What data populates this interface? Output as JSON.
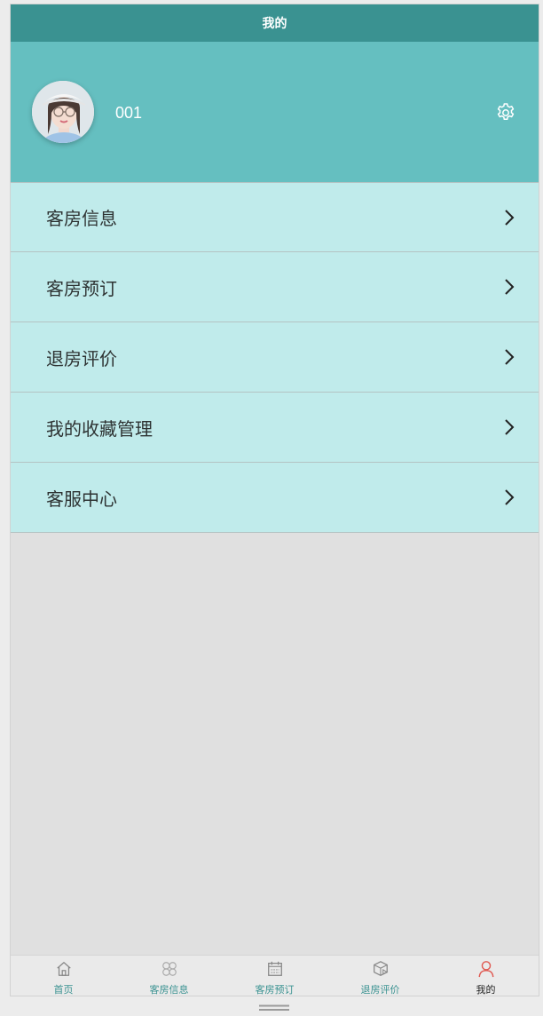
{
  "header": {
    "title": "我的"
  },
  "profile": {
    "username": "001",
    "avatar_icon": "avatar",
    "settings_icon": "gear-icon"
  },
  "menu": {
    "items": [
      {
        "label": "客房信息",
        "icon": "chevron-right-icon"
      },
      {
        "label": "客房预订",
        "icon": "chevron-right-icon"
      },
      {
        "label": "退房评价",
        "icon": "chevron-right-icon"
      },
      {
        "label": "我的收藏管理",
        "icon": "chevron-right-icon"
      },
      {
        "label": "客服中心",
        "icon": "chevron-right-icon"
      }
    ]
  },
  "tabbar": {
    "items": [
      {
        "label": "首页",
        "icon": "home-icon",
        "active": false
      },
      {
        "label": "客房信息",
        "icon": "grid-icon",
        "active": false
      },
      {
        "label": "客房预订",
        "icon": "calendar-icon",
        "active": false
      },
      {
        "label": "退房评价",
        "icon": "box-icon",
        "active": false
      },
      {
        "label": "我的",
        "icon": "user-icon",
        "active": true
      }
    ]
  },
  "colors": {
    "header_bg": "#3a9291",
    "profile_bg": "#65bfc0",
    "menu_item_bg": "#c0ebeb",
    "tab_label": "#3a9291",
    "tab_active_icon": "#e05a52",
    "page_bg": "#e0e0e0"
  }
}
